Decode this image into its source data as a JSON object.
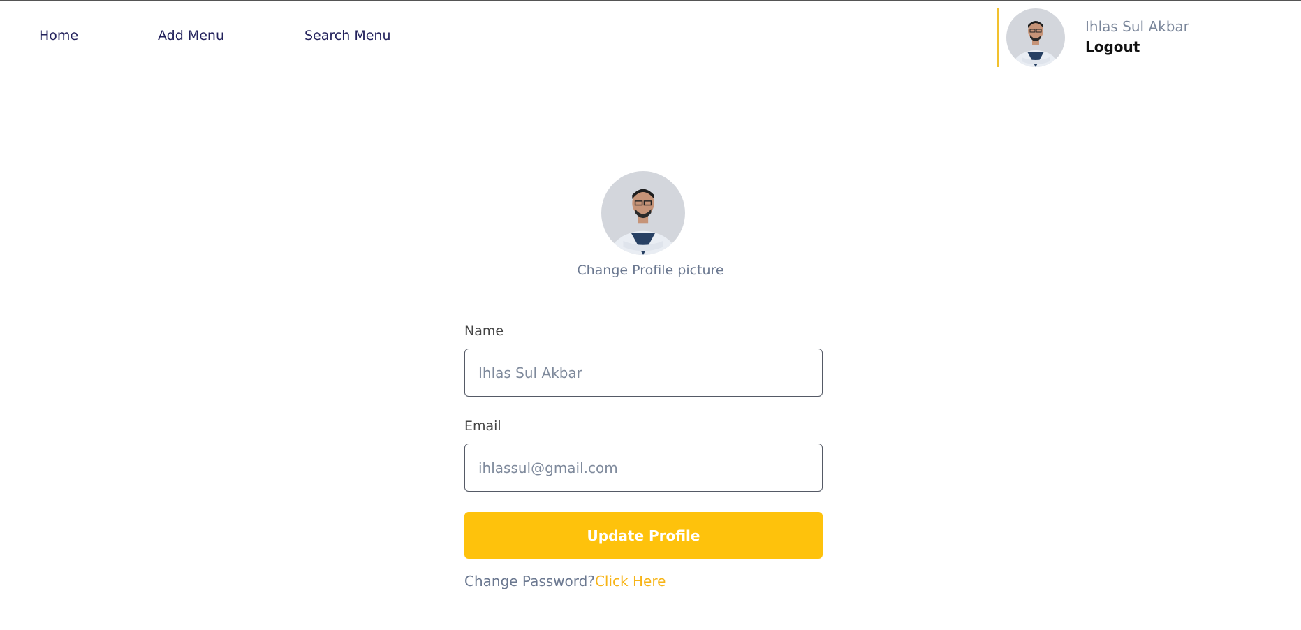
{
  "nav": {
    "items": [
      {
        "label": "Home"
      },
      {
        "label": "Add Menu"
      },
      {
        "label": "Search Menu"
      }
    ]
  },
  "user": {
    "name": "Ihlas Sul Akbar",
    "logout_label": "Logout"
  },
  "profile": {
    "change_picture_label": "Change Profile picture"
  },
  "form": {
    "name_label": "Name",
    "name_placeholder": "Ihlas Sul Akbar",
    "email_label": "Email",
    "email_placeholder": "ihlassul@gmail.com",
    "submit_label": "Update Profile",
    "change_password_text": "Change Password?",
    "change_password_link": "Click Here"
  },
  "colors": {
    "accent": "#fec20c",
    "nav_text": "#23225c",
    "muted_text": "#7a869a"
  }
}
